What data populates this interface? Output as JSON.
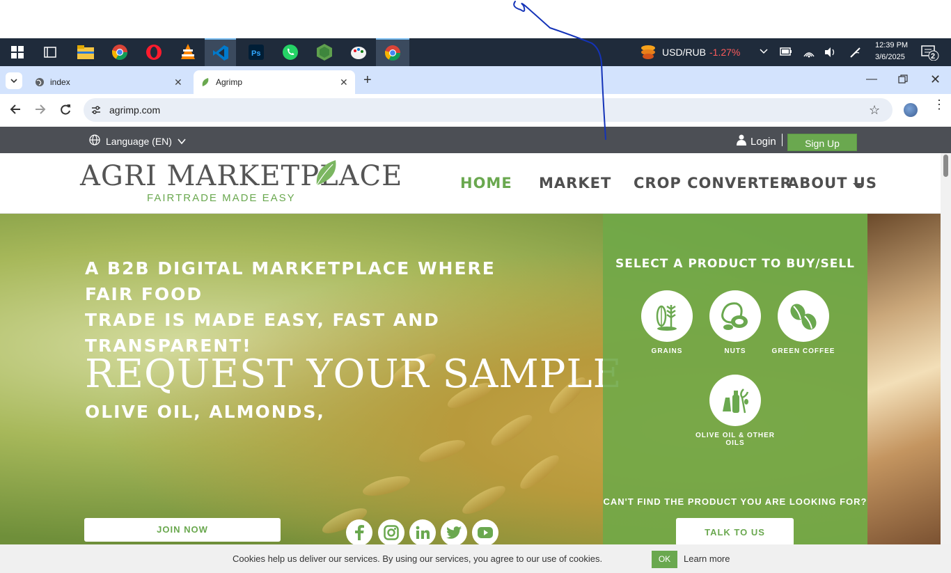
{
  "taskbar": {
    "ticker_label": "USD/RUB",
    "ticker_change": "-1.27%",
    "time": "12:39 PM",
    "date": "3/6/2025",
    "notification_count": "2",
    "apps": [
      "windows-start",
      "task-view",
      "file-explorer",
      "chrome",
      "opera",
      "vlc",
      "vscode",
      "photoshop",
      "whatsapp",
      "nodejs",
      "paint",
      "chrome-active"
    ]
  },
  "browser": {
    "tabs": [
      {
        "label": "index"
      },
      {
        "label": "Agrimp"
      }
    ],
    "url": "agrimp.com"
  },
  "site": {
    "topbar": {
      "language": "Language (EN)",
      "login": "Login",
      "signup": "Sign Up"
    },
    "logo": {
      "main": "AGRI MARKETPLACE",
      "tagline": "FAIRTRADE MADE EASY"
    },
    "nav": [
      {
        "label": "HOME"
      },
      {
        "label": "MARKET"
      },
      {
        "label": "CROP CONVERTER"
      },
      {
        "label": "ABOUT US"
      }
    ],
    "hero": {
      "headline_line1": "A B2B DIGITAL MARKETPLACE WHERE FAIR FOOD",
      "headline_line2": "TRADE IS MADE EASY, FAST AND TRANSPARENT!",
      "request": "REQUEST YOUR SAMPLE",
      "request_sub": "OLIVE OIL, ALMONDS,",
      "join": "JOIN NOW",
      "social": [
        "facebook-icon",
        "instagram-icon",
        "linkedin-icon",
        "twitter-icon",
        "youtube-icon"
      ]
    },
    "panel": {
      "title": "SELECT A PRODUCT TO BUY/SELL",
      "products": [
        {
          "label": "GRAINS"
        },
        {
          "label": "NUTS"
        },
        {
          "label": "GREEN COFFEE"
        },
        {
          "label": "OLIVE OIL & OTHER OILS"
        }
      ],
      "cant_find": "CAN'T FIND THE PRODUCT YOU ARE LOOKING FOR?",
      "talk": "TALK TO US"
    },
    "cookie": {
      "text": "Cookies help us deliver our services. By using our services, you agree to our use of cookies.",
      "ok": "OK",
      "learn_more": "Learn more"
    }
  },
  "colors": {
    "brand_green": "#6aa84f",
    "taskbar": "#1f2b3b",
    "tabstrip": "#d3e3fd",
    "ticker_negative": "#ff5b5b"
  }
}
